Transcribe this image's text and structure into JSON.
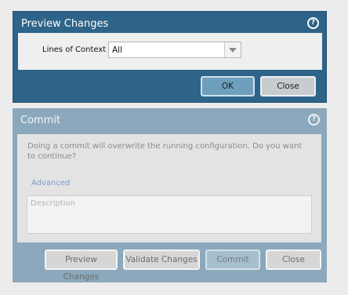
{
  "preview_dialog": {
    "title": "Preview Changes",
    "help_icon": "?",
    "lines_of_context_label": "Lines of Context",
    "lines_of_context_value": "All",
    "ok_label": "OK",
    "close_label": "Close"
  },
  "commit_dialog": {
    "title": "Commit",
    "help_icon": "?",
    "message": "Doing a commit will overwrite the running configuration. Do you want to continue?",
    "advanced_link": "Advanced",
    "description_placeholder": "Description",
    "preview_changes_label": "Preview Changes",
    "validate_changes_label": "Validate Changes",
    "commit_label": "Commit",
    "close_label": "Close"
  },
  "colors": {
    "active_title_bar": "#2e6489",
    "inactive_title_bar": "#8ba8bc",
    "primary_button": "#6ea0bd",
    "link": "#7c9bcf"
  }
}
